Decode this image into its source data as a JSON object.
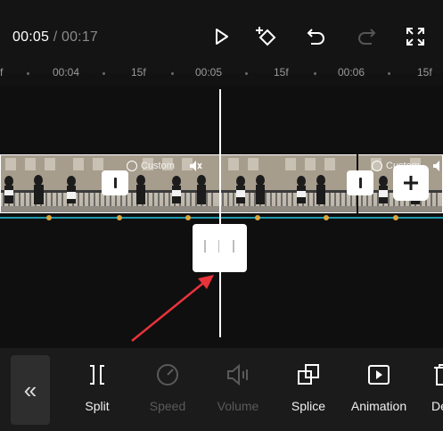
{
  "header": {
    "current_time": "00:05",
    "separator": " / ",
    "total_time": "00:17"
  },
  "ruler": {
    "labels": [
      "f",
      "00:04",
      "15f",
      "00:05",
      "15f",
      "00:06",
      "15f"
    ]
  },
  "clips": {
    "badge_label": "Custom",
    "badge_label_2": "Custom"
  },
  "toolbar": {
    "collapse_glyph": "«",
    "items": [
      {
        "label": "Split",
        "enabled": true
      },
      {
        "label": "Speed",
        "enabled": false
      },
      {
        "label": "Volume",
        "enabled": false
      },
      {
        "label": "Splice",
        "enabled": true
      },
      {
        "label": "Animation",
        "enabled": true
      },
      {
        "label": "De",
        "enabled": true
      }
    ]
  },
  "colors": {
    "accent_line": "#1f9bb0",
    "keyframe": "#e0a63a",
    "annotation_arrow": "#e8333a"
  }
}
